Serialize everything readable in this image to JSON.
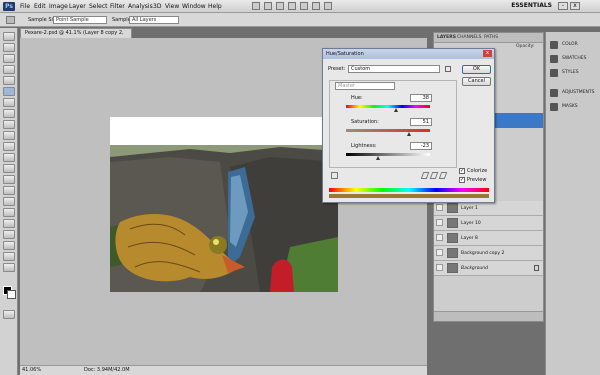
{
  "menu": {
    "items": [
      "File",
      "Edit",
      "Image",
      "Layer",
      "Select",
      "Filter",
      "Analysis",
      "3D",
      "View",
      "Window",
      "Help"
    ],
    "workspace": "ESSENTIALS"
  },
  "options": {
    "sample_size_label": "Sample Size:",
    "sample_size_value": "Point Sample",
    "sample_label": "Sample:",
    "sample_value": "All Layers"
  },
  "document": {
    "tab_title": "Pexare-2.psd @ 41.1% (Layer 8 copy 2, RGB/8) *",
    "zoom": "41.06%",
    "doc_size": "Doc: 3.94M/42.0M"
  },
  "panels": {
    "tabs": [
      "LAYERS",
      "CHANNELS",
      "PATHS"
    ],
    "opacity_label": "Opacity:",
    "layers": [
      "Layer 1",
      "Layer 10",
      "Layer 8",
      "Background copy 2",
      "Background"
    ]
  },
  "dock": {
    "items": [
      {
        "label": "COLOR",
        "icon": "color-icon"
      },
      {
        "label": "SWATCHES",
        "icon": "swatches-icon"
      },
      {
        "label": "STYLES",
        "icon": "styles-icon"
      },
      {
        "label": "ADJUSTMENTS",
        "icon": "adjustments-icon"
      },
      {
        "label": "MASKS",
        "icon": "masks-icon"
      }
    ]
  },
  "dialog": {
    "title": "Hue/Saturation",
    "preset_label": "Preset:",
    "preset_value": "Custom",
    "channel_value": "Master",
    "ok": "OK",
    "cancel": "Cancel",
    "hue_label": "Hue:",
    "hue_value": "38",
    "hue_level": 0.606,
    "saturation_label": "Saturation:",
    "saturation_value": "51",
    "saturation_level": 0.755,
    "lightness_label": "Lightness:",
    "lightness_value": "-23",
    "lightness_level": 0.385,
    "colorize_label": "Colorize",
    "colorize_checked": true,
    "preview_label": "Preview",
    "preview_checked": true
  }
}
